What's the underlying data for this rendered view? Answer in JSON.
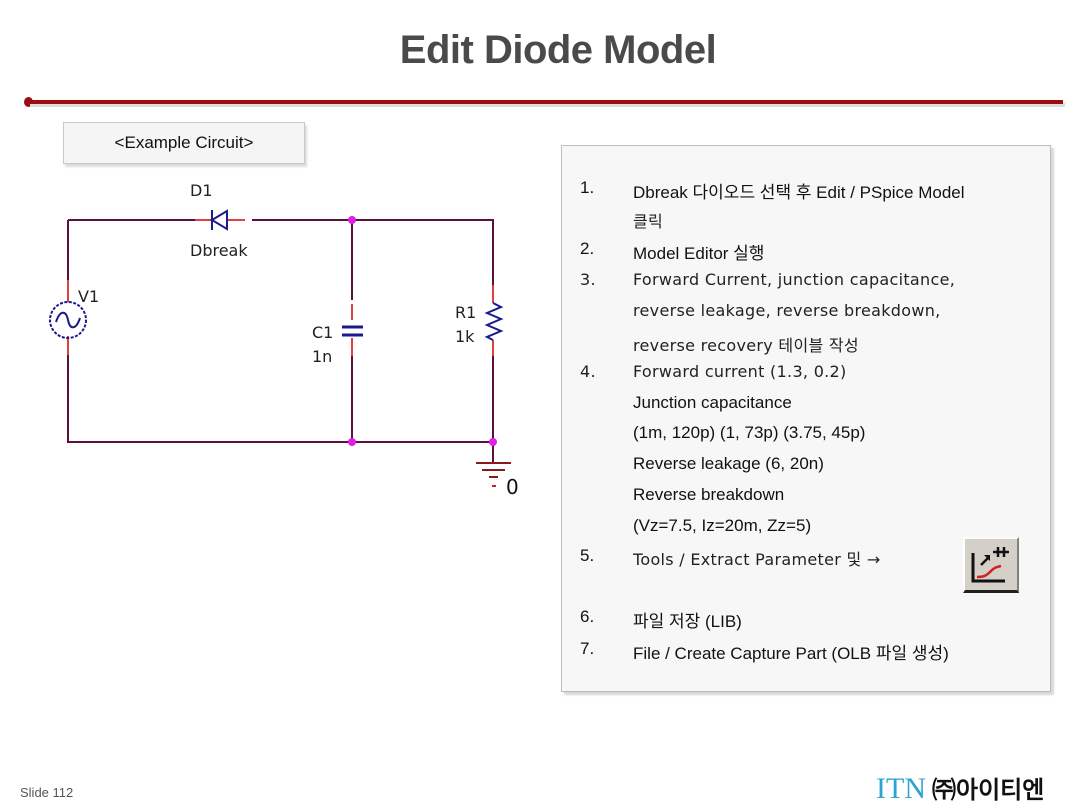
{
  "slide": {
    "title": "Edit Diode Model",
    "accent_color": "#9b0d12",
    "slide_number": "Slide 112"
  },
  "example": {
    "label": "<Example Circuit>"
  },
  "circuit": {
    "diode": {
      "ref": "D1",
      "model": "Dbreak"
    },
    "source": {
      "ref": "V1"
    },
    "capacitor": {
      "ref": "C1",
      "value": "1n"
    },
    "resistor": {
      "ref": "R1",
      "value": "1k"
    },
    "ground": {
      "label": "0"
    },
    "wire_color": "#5a1040",
    "symbol_color": "#1a1a8c",
    "junction_color": "#e020e0"
  },
  "steps": [
    {
      "num": "1.",
      "lines": [
        "Dbreak 다이오드 선택 후 Edit / PSpice Model",
        "클릭"
      ]
    },
    {
      "num": "2.",
      "lines": [
        "Model Editor 실행"
      ]
    },
    {
      "num": "3.",
      "lines": [
        "Forward Current, junction capacitance,",
        "reverse leakage, reverse breakdown,",
        "reverse recovery  테이블 작성"
      ]
    },
    {
      "num": "4.",
      "lines": [
        "Forward current  (1.3, 0.2)",
        "Junction capacitance",
        "(1m, 120p) (1, 73p) (3.75, 45p)",
        "Reverse leakage  (6, 20n)",
        "Reverse breakdown",
        "(Vz=7.5, Iz=20m, Zz=5)"
      ]
    },
    {
      "num": "5.",
      "lines": [
        "Tools / Extract Parameter 및  →"
      ]
    },
    {
      "num": "6.",
      "lines": [
        "파일 저장 (LIB)"
      ]
    },
    {
      "num": "7.",
      "lines": [
        "File / Create Capture Part (OLB 파일 생성)"
      ]
    }
  ],
  "toolbar_icon": {
    "name": "extract-parameter-icon"
  },
  "footer": {
    "brand_latin": "ITN",
    "brand_korean": "㈜아이티엔",
    "brand_color": "#2ba5cf"
  }
}
